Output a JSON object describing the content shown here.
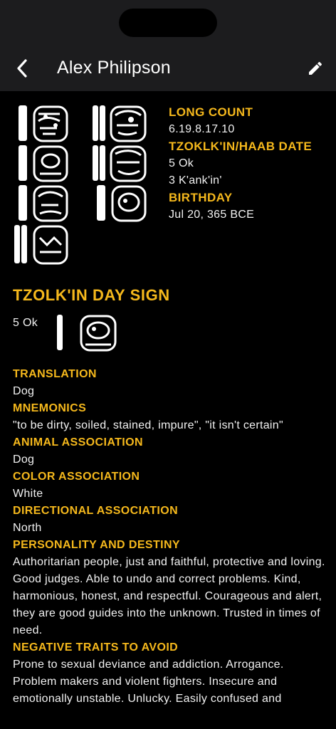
{
  "nav": {
    "title": "Alex Philipson"
  },
  "info": {
    "long_count_label": "LONG COUNT",
    "long_count_value": "6.19.8.17.10",
    "tzolkin_haab_label": "TZOKLK'IN/HAAB DATE",
    "tzolkin_value": "5 Ok",
    "haab_value": "3 K'ank'in'",
    "birthday_label": "BIRTHDAY",
    "birthday_value": "Jul 20, 365 BCE"
  },
  "day_sign": {
    "title": "TZOLK'IN DAY SIGN",
    "value": "5 Ok"
  },
  "details": [
    {
      "label": "TRANSLATION",
      "value": "Dog"
    },
    {
      "label": "MNEMONICS",
      "value": "\"to be dirty, soiled, stained, impure\", \"it isn't certain\""
    },
    {
      "label": "ANIMAL ASSOCIATION",
      "value": "Dog"
    },
    {
      "label": "COLOR ASSOCIATION",
      "value": "White"
    },
    {
      "label": "DIRECTIONAL ASSOCIATION",
      "value": "North"
    },
    {
      "label": "PERSONALITY AND DESTINY",
      "value": "Authoritarian people, just and faithful, protective and loving.  Good judges. Able to undo and correct problems.  Kind, harmonious, honest, and respectful. Courageous and alert, they are good guides into the unknown. Trusted in times of need."
    },
    {
      "label": "NEGATIVE TRAITS TO AVOID",
      "value": "Prone to sexual deviance and addiction. Arrogance. Problem makers and violent fighters.  Insecure and emotionally unstable. Unlucky. Easily confused and"
    }
  ],
  "icons": {
    "back": "chevron-left-icon",
    "edit": "pencil-icon"
  },
  "colors": {
    "accent": "#f5b81c",
    "background": "#000000",
    "navbar": "#1c1c1e"
  }
}
